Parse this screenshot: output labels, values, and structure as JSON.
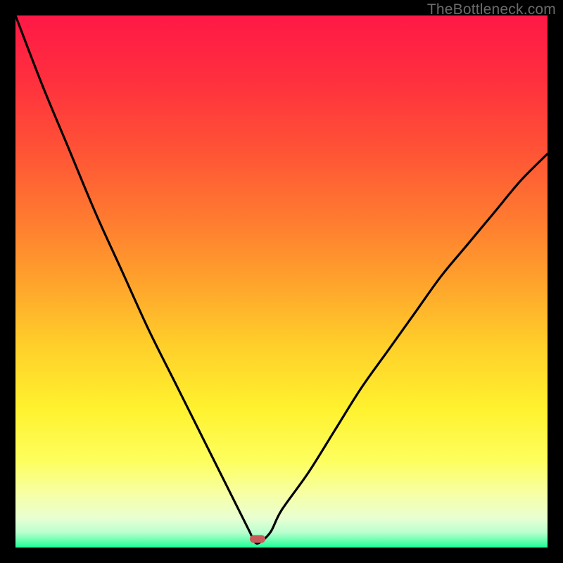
{
  "watermark": "TheBottleneck.com",
  "chart_data": {
    "type": "line",
    "title": "",
    "xlabel": "",
    "ylabel": "",
    "xlim": [
      0,
      100
    ],
    "ylim": [
      0,
      100
    ],
    "x": [
      0,
      5,
      10,
      15,
      20,
      25,
      30,
      35,
      40,
      42,
      44,
      45,
      46,
      48,
      50,
      55,
      60,
      65,
      70,
      75,
      80,
      85,
      90,
      95,
      100
    ],
    "values": [
      100,
      87,
      75,
      63,
      52,
      41,
      31,
      21,
      11,
      7,
      3,
      1,
      1,
      3,
      7,
      14,
      22,
      30,
      37,
      44,
      51,
      57,
      63,
      69,
      74
    ],
    "minimum_marker": {
      "x": 45.5,
      "y": 1.6,
      "color": "#c95a5a"
    },
    "background_gradient": {
      "stops": [
        {
          "offset": 0.0,
          "color": "#ff1846"
        },
        {
          "offset": 0.12,
          "color": "#ff2f3e"
        },
        {
          "offset": 0.25,
          "color": "#ff5236"
        },
        {
          "offset": 0.38,
          "color": "#ff7a30"
        },
        {
          "offset": 0.5,
          "color": "#ffa22c"
        },
        {
          "offset": 0.62,
          "color": "#ffcf2a"
        },
        {
          "offset": 0.74,
          "color": "#fff22e"
        },
        {
          "offset": 0.84,
          "color": "#fdff60"
        },
        {
          "offset": 0.9,
          "color": "#f7ffa6"
        },
        {
          "offset": 0.945,
          "color": "#e8ffd2"
        },
        {
          "offset": 0.972,
          "color": "#b9ffcf"
        },
        {
          "offset": 0.986,
          "color": "#6cffb0"
        },
        {
          "offset": 1.0,
          "color": "#1aff99"
        }
      ]
    }
  }
}
